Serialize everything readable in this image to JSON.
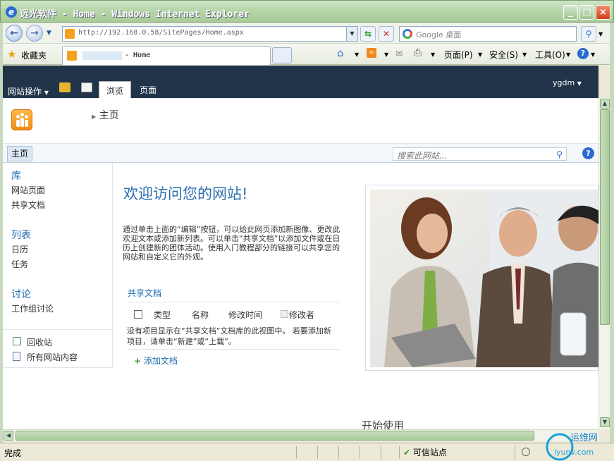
{
  "window": {
    "title": "远光软件 - Home - Windows Internet Explorer",
    "minimize_label": "_",
    "maximize_label": "□",
    "close_label": "×"
  },
  "browser": {
    "back_label": "←",
    "forward_label": "→",
    "address": "http://192.168.0.58/SitePages/Home.aspx",
    "search_placeholder": "Google 桌面",
    "favorites_label": "收藏夹",
    "tab_title": "- Home",
    "page_menu": "页面(P)",
    "safety_menu": "安全(S)",
    "tools_menu": "工具(O)",
    "status_text": "完成",
    "trusted_zone": "可信站点"
  },
  "ribbon": {
    "site_actions": "网站操作",
    "tab_browse": "浏览",
    "tab_page": "页面",
    "user": "ygdm"
  },
  "site": {
    "breadcrumb": "主页",
    "nav_home": "主页",
    "search_placeholder": "搜索此网站..."
  },
  "leftnav": {
    "libraries_header": "库",
    "libraries": [
      "网站页面",
      "共享文档"
    ],
    "lists_header": "列表",
    "lists": [
      "日历",
      "任务"
    ],
    "discussions_header": "讨论",
    "discussions": [
      "工作组讨论"
    ],
    "recycle_bin": "回收站",
    "all_site_content": "所有网站内容"
  },
  "main": {
    "welcome_title": "欢迎访问您的网站!",
    "intro_text": "通过单击上面的“编辑”按钮，可以给此网页添加新图像、更改此欢迎文本或添加新列表。可以单击“共享文档”以添加文件或在日历上创建新的团体活动。使用入门教程部分的链接可以共享您的网站和自定义它的外观。",
    "shared_docs_title": "共享文档",
    "columns": [
      "类型",
      "名称",
      "修改时间",
      "修改者"
    ],
    "empty_message": "没有项目显示在“共享文档”文档库的此视图中。 若要添加新项目，请单击“新建”或“上载”。",
    "add_document": "添加文档",
    "get_started": "开始使用"
  },
  "watermark": {
    "text": "运维网",
    "sub": "iyunv.com"
  }
}
